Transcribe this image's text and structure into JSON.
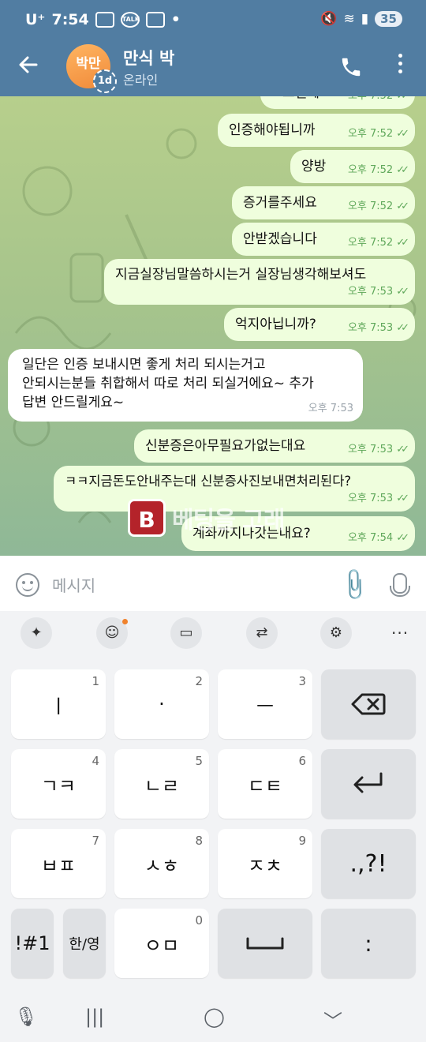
{
  "status_bar": {
    "carrier": "U⁺",
    "time": "7:54",
    "notif_icons": [
      "screenshot-icon",
      "kakaotalk-icon",
      "scan-icon"
    ],
    "dot": "•",
    "battery": "35"
  },
  "header": {
    "avatar_text": "박만",
    "avatar_badge": "1d",
    "contact_name": "만식 박",
    "contact_status": "온라인"
  },
  "messages": [
    {
      "dir": "out",
      "text": "그럴께",
      "time": "오후 7:52",
      "read": true
    },
    {
      "dir": "out",
      "text": "인증해야됩니까",
      "time": "오후 7:52",
      "read": true
    },
    {
      "dir": "out",
      "text": "양방",
      "time": "오후 7:52",
      "read": true
    },
    {
      "dir": "out",
      "text": "증거를주세요",
      "time": "오후 7:52",
      "read": true
    },
    {
      "dir": "out",
      "text": "안받겠습니다",
      "time": "오후 7:52",
      "read": true
    },
    {
      "dir": "out",
      "text": "지금실장님말씀하시는거 실장님생각해보셔도",
      "time": "오후 7:53",
      "read": true
    },
    {
      "dir": "out",
      "text": "억지아닙니까?",
      "time": "오후 7:53",
      "read": true
    },
    {
      "dir": "in",
      "lines": [
        "일단은 인증 보내시면 좋게 처리 되시는거고",
        "안되시는분들 취합해서 따로 처리 되실거에요~ 추가",
        "답변 안드릴게요~"
      ],
      "time": "오후 7:53"
    },
    {
      "dir": "out",
      "text": "신분증은아무필요가없는대요",
      "time": "오후 7:53",
      "read": true
    },
    {
      "dir": "out",
      "text": "ㅋㅋ지금돈도안내주는대 신분증사진보내면처리된다?",
      "time": "오후 7:53",
      "read": true
    },
    {
      "dir": "out",
      "text": "계좌까지나갓는내요?",
      "time": "오후 7:54",
      "read": true
    }
  ],
  "watermark": {
    "logo": "B",
    "text": "베팅을 고래"
  },
  "input": {
    "placeholder": "메시지"
  },
  "keyboard": {
    "toolbar": [
      "ai-sparkle-icon",
      "emoji-icon",
      "clipboard-icon",
      "translate-icon",
      "settings-icon"
    ],
    "toolbar_more": "···",
    "rows": [
      [
        {
          "label": "ㅣ",
          "num": "1"
        },
        {
          "label": "·",
          "num": "2"
        },
        {
          "label": "ㅡ",
          "num": "3"
        },
        {
          "label": "⌫",
          "num": "",
          "gray": true,
          "name": "backspace-key"
        }
      ],
      [
        {
          "label": "ㄱㅋ",
          "num": "4"
        },
        {
          "label": "ㄴㄹ",
          "num": "5"
        },
        {
          "label": "ㄷㅌ",
          "num": "6"
        },
        {
          "label": "↵",
          "num": "",
          "gray": true,
          "name": "enter-key"
        }
      ],
      [
        {
          "label": "ㅂㅍ",
          "num": "7"
        },
        {
          "label": "ㅅㅎ",
          "num": "8"
        },
        {
          "label": "ㅈㅊ",
          "num": "9"
        },
        {
          "label": ".,?!",
          "num": "",
          "gray": true,
          "name": "punctuation-key"
        }
      ],
      [
        {
          "label": "!#1",
          "num": "",
          "gray": true,
          "name": "symbols-key"
        },
        {
          "label": "한/영",
          "num": "",
          "gray": true,
          "name": "lang-switch-key"
        },
        {
          "label": "ㅇㅁ",
          "num": "0"
        },
        {
          "label": "⎵",
          "num": "",
          "gray": true,
          "name": "space-key"
        },
        {
          "label": ":",
          "num": "",
          "gray": true,
          "name": "colon-key"
        }
      ]
    ]
  },
  "navbar": {
    "mic": "🎙",
    "recents": "|||",
    "home": "◯",
    "back": "﹀"
  }
}
